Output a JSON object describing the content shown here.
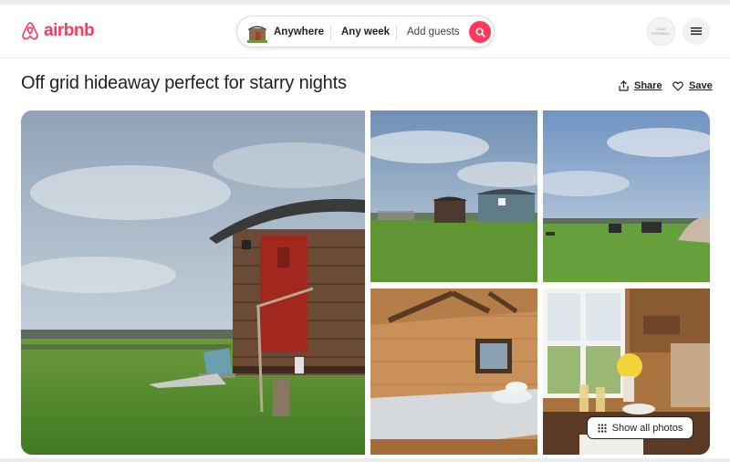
{
  "brand": {
    "name": "airbnb",
    "color": "#ff385c",
    "logo_icon": "airbnb-belo-icon"
  },
  "search": {
    "location": "Anywhere",
    "dates": "Any week",
    "guests": "Add guests",
    "search_icon": "search-icon"
  },
  "profile": {
    "avatar_text_line1": "AGUE",
    "avatar_text_line2": "CORNWALL"
  },
  "menu_icon": "hamburger-icon",
  "listing": {
    "title": "Off grid hideaway perfect for starry nights",
    "share_label": "Share",
    "save_label": "Save",
    "show_all_photos_label": "Show all photos"
  },
  "photos": [
    {
      "name": "shepherds-hut-exterior"
    },
    {
      "name": "huts-in-field"
    },
    {
      "name": "field-with-seating-and-tent"
    },
    {
      "name": "hut-interior-bed"
    },
    {
      "name": "window-breakfast-table"
    }
  ]
}
